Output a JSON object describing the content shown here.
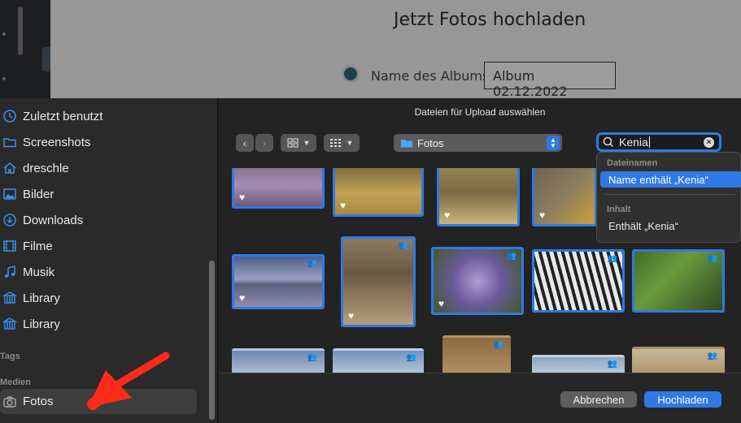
{
  "background_page": {
    "title": "Jetzt Fotos hochladen",
    "album_label": "Name des Albums",
    "album_value": "Album 02.12.2022"
  },
  "dialog": {
    "title": "Dateien für Upload auswählen",
    "sidebar": {
      "items": [
        {
          "label": "Zuletzt benutzt",
          "icon": "clock-icon"
        },
        {
          "label": "Screenshots",
          "icon": "folder-icon"
        },
        {
          "label": "dreschle",
          "icon": "home-icon"
        },
        {
          "label": "Bilder",
          "icon": "photos-icon"
        },
        {
          "label": "Downloads",
          "icon": "download-icon"
        },
        {
          "label": "Filme",
          "icon": "film-icon"
        },
        {
          "label": "Musik",
          "icon": "music-icon"
        },
        {
          "label": "Library",
          "icon": "library-icon"
        },
        {
          "label": "Library",
          "icon": "library-icon"
        }
      ],
      "tags_section": "Tags",
      "media_section": "Medien",
      "media_items": [
        {
          "label": "Fotos",
          "icon": "camera-icon",
          "selected": true
        }
      ]
    },
    "toolbar": {
      "back_icon": "chevron-left-icon",
      "forward_icon": "chevron-right-icon",
      "view_icon": "grid-icon",
      "group_icon": "grid-small-icon",
      "location": "Fotos",
      "search_value": "Kenia"
    },
    "search_suggestions": {
      "section1": "Dateinamen",
      "item1": "Name enthält „Kenia“",
      "section2": "Inhalt",
      "item2": "Enthält „Kenia“"
    },
    "buttons": {
      "cancel": "Abbrechen",
      "upload": "Hochladen"
    }
  },
  "colors": {
    "accent": "#2f79e6",
    "annotation_arrow": "#ff2a1a"
  }
}
